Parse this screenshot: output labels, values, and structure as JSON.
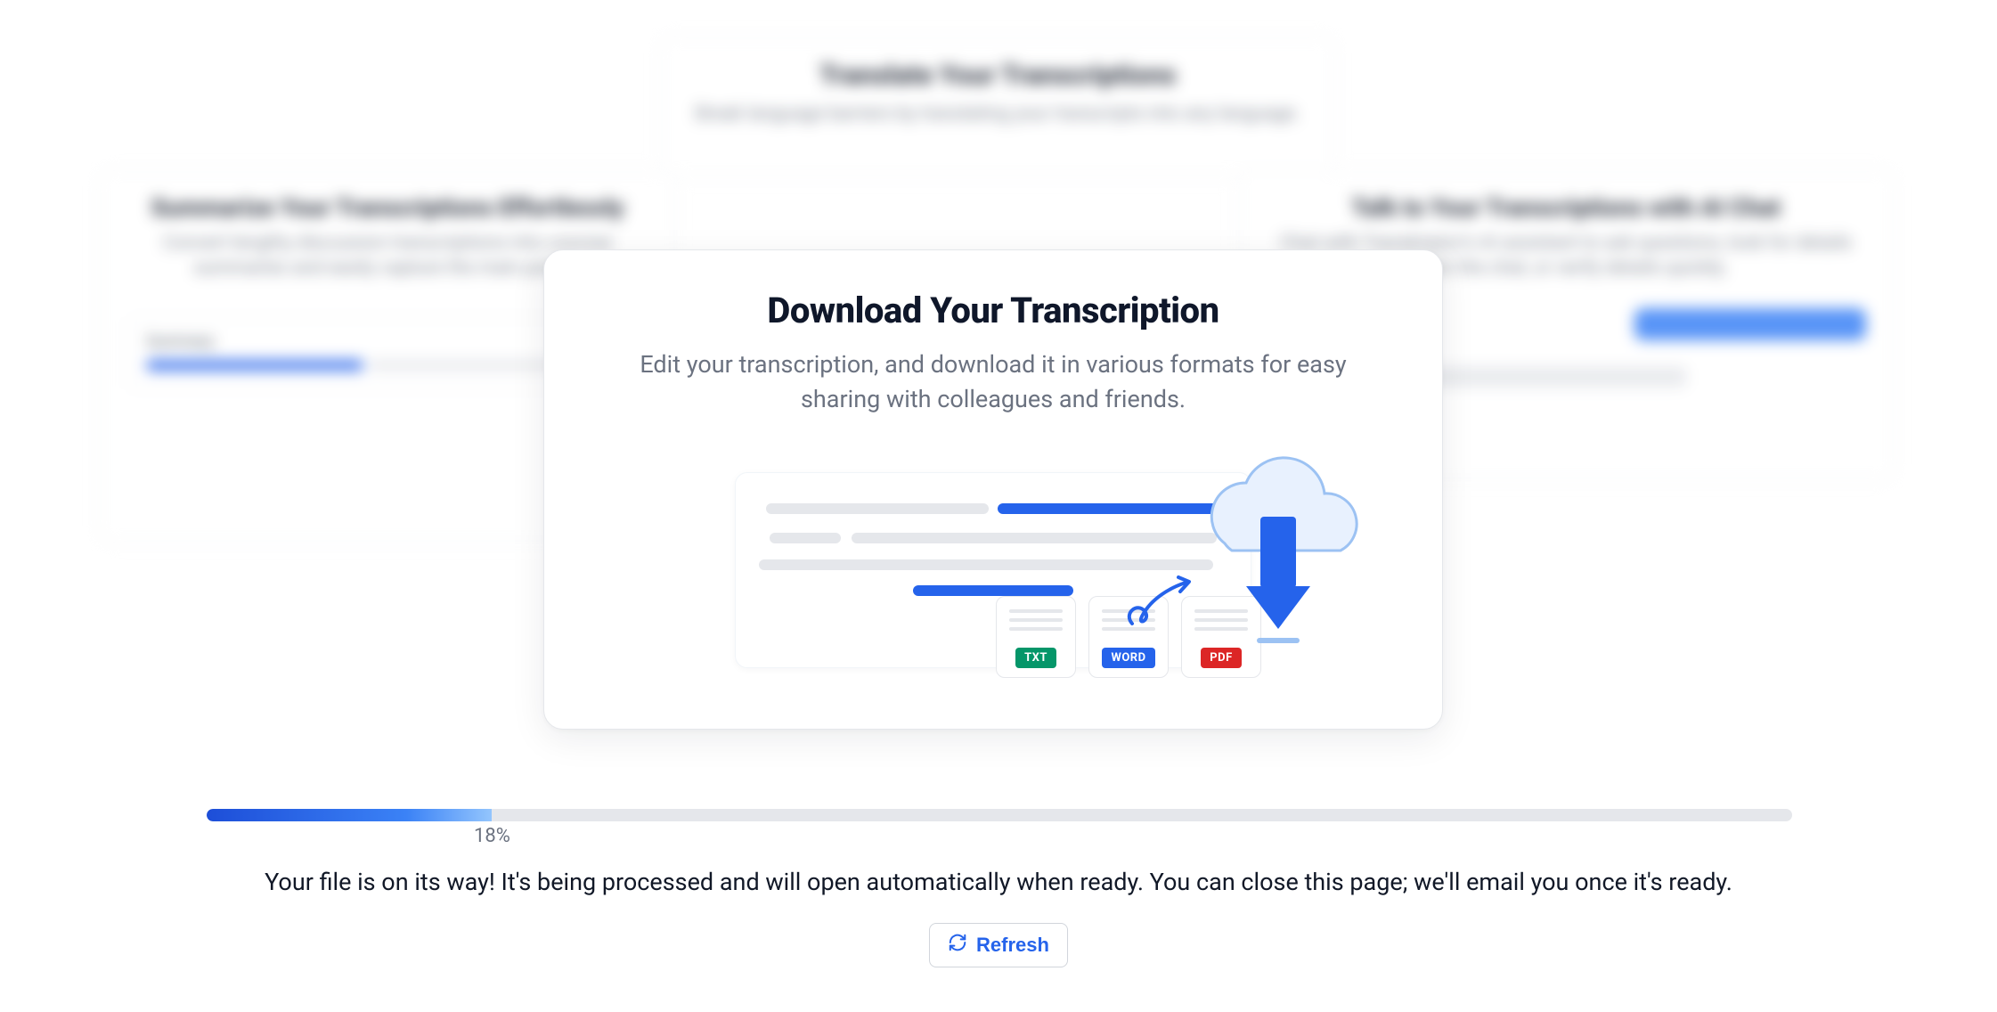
{
  "background_cards": {
    "top": {
      "title": "Translate Your Transcriptions",
      "desc": "Break language barriers by translating your transcripts into any language."
    },
    "left": {
      "title": "Summarize Your Transcriptions Effortlessly",
      "desc": "Convert lengthy discussion transcriptions into concise summaries and easily capture the main points.",
      "panel_label": "Summary"
    },
    "right": {
      "title": "Talk to Your Transcriptions with AI Chat",
      "desc": "Chat with Transkriptor's AI assistant to ask questions, look for details within the chat, or verify details quickly."
    }
  },
  "modal": {
    "title": "Download Your Transcription",
    "desc": "Edit your transcription, and download it in various formats for easy sharing with colleagues and friends.",
    "formats": {
      "txt": "TXT",
      "word": "WORD",
      "pdf": "PDF"
    }
  },
  "progress": {
    "percent": 18,
    "label": "18%"
  },
  "status_text": "Your file is on its way! It's being processed and will open automatically when ready. You can close this page; we'll email you once it's ready.",
  "refresh_label": "Refresh",
  "colors": {
    "primary": "#2563eb",
    "muted": "#6b7280",
    "track": "#e5e7eb"
  }
}
